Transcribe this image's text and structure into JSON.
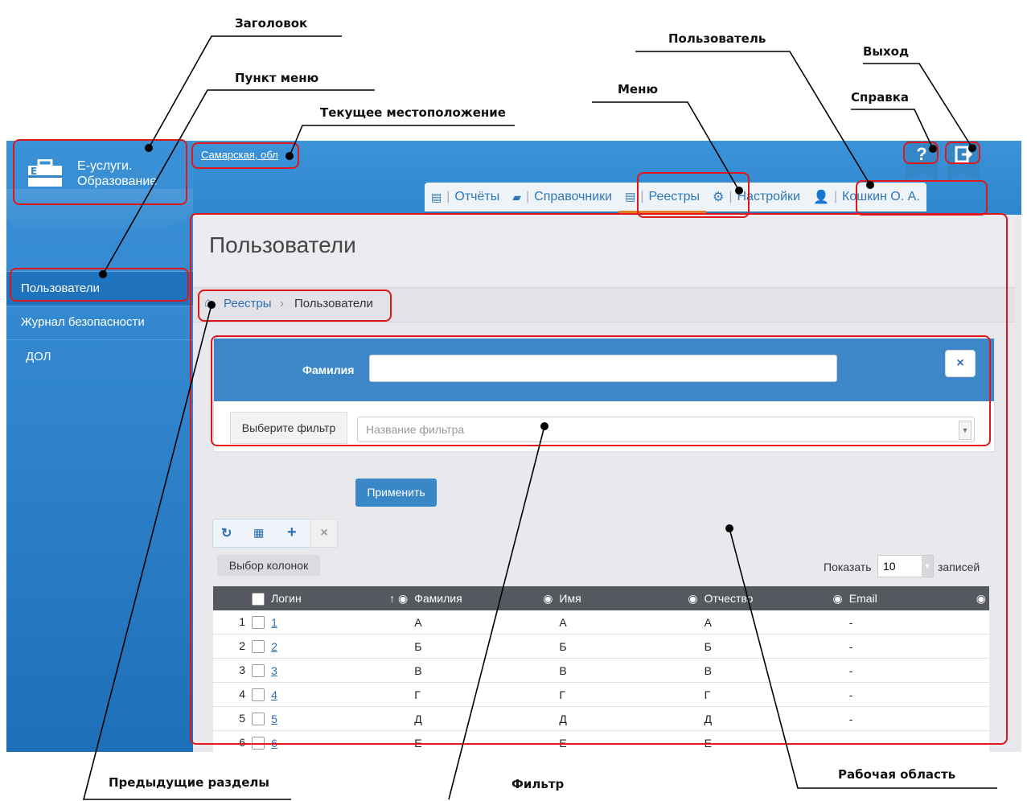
{
  "annotations": {
    "header": "Заголовок",
    "menu_item": "Пункт меню",
    "current_location": "Текущее местоположение",
    "menu": "Меню",
    "user": "Пользователь",
    "help": "Справка",
    "exit": "Выход",
    "previous_sections": "Предыдущие разделы",
    "filter": "Фильтр",
    "work_area": "Рабочая область"
  },
  "app": {
    "title_line1": "Е-услуги.",
    "title_line2": "Образование",
    "location": "Самарская, обл"
  },
  "topnav": {
    "reports": "Отчёты",
    "directories": "Справочники",
    "registries": "Реестры",
    "settings": "Настройки",
    "user": "Кошкин О. А.",
    "help_glyph": "?"
  },
  "sidebar": {
    "items": [
      {
        "label": "Пользователи"
      },
      {
        "label": "Журнал безопасности"
      },
      {
        "label": "ДОЛ"
      }
    ]
  },
  "page": {
    "title": "Пользователи",
    "breadcrumb": [
      "Реестры",
      "Пользователи"
    ]
  },
  "filter": {
    "surname_label": "Фамилия",
    "surname_value": "",
    "select_label": "Выберите фильтр",
    "select_placeholder": "Название фильтра",
    "apply": "Применить"
  },
  "toolbar": {
    "columns": "Выбор колонок",
    "show": "Показать",
    "page_size": "10",
    "records": "записей"
  },
  "table": {
    "columns": [
      "Логин",
      "Фамилия",
      "Имя",
      "Отчество",
      "Email"
    ],
    "rows": [
      {
        "n": "1",
        "login": "1",
        "surname": "А",
        "name": "А",
        "patronymic": "А",
        "email": "-"
      },
      {
        "n": "2",
        "login": "2",
        "surname": "Б",
        "name": "Б",
        "patronymic": "Б",
        "email": "-"
      },
      {
        "n": "3",
        "login": "3",
        "surname": "В",
        "name": "В",
        "patronymic": "В",
        "email": "-"
      },
      {
        "n": "4",
        "login": "4",
        "surname": "Г",
        "name": "Г",
        "patronymic": "Г",
        "email": "-"
      },
      {
        "n": "5",
        "login": "5",
        "surname": "Д",
        "name": "Д",
        "patronymic": "Д",
        "email": "-"
      },
      {
        "n": "6",
        "login": "6",
        "surname": "Е",
        "name": "Е",
        "patronymic": "Е",
        "email": "-"
      }
    ]
  },
  "colors": {
    "brand_blue": "#2f84cc",
    "highlight_red": "#e0161b",
    "active_tab_accent": "#e67e22"
  }
}
